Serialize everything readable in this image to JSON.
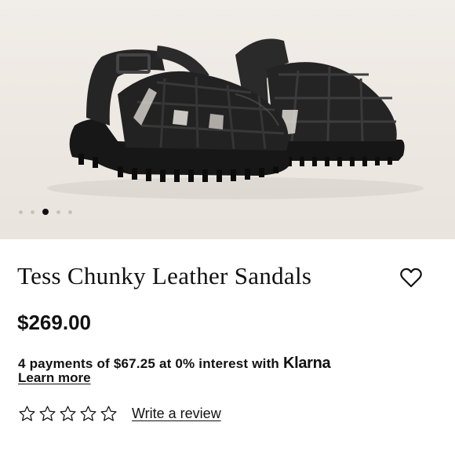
{
  "product": {
    "image": {
      "icon": "product-photo",
      "carousel_total": 5,
      "carousel_active_index": 2
    },
    "title": "Tess Chunky Leather Sandals",
    "price": "$269.00",
    "installments": {
      "text": "4 payments of $67.25 at 0% interest with ",
      "provider": "Klarna",
      "learn_more": "Learn more"
    },
    "rating": {
      "stars": 0,
      "max": 5,
      "write_review": "Write a review"
    }
  }
}
